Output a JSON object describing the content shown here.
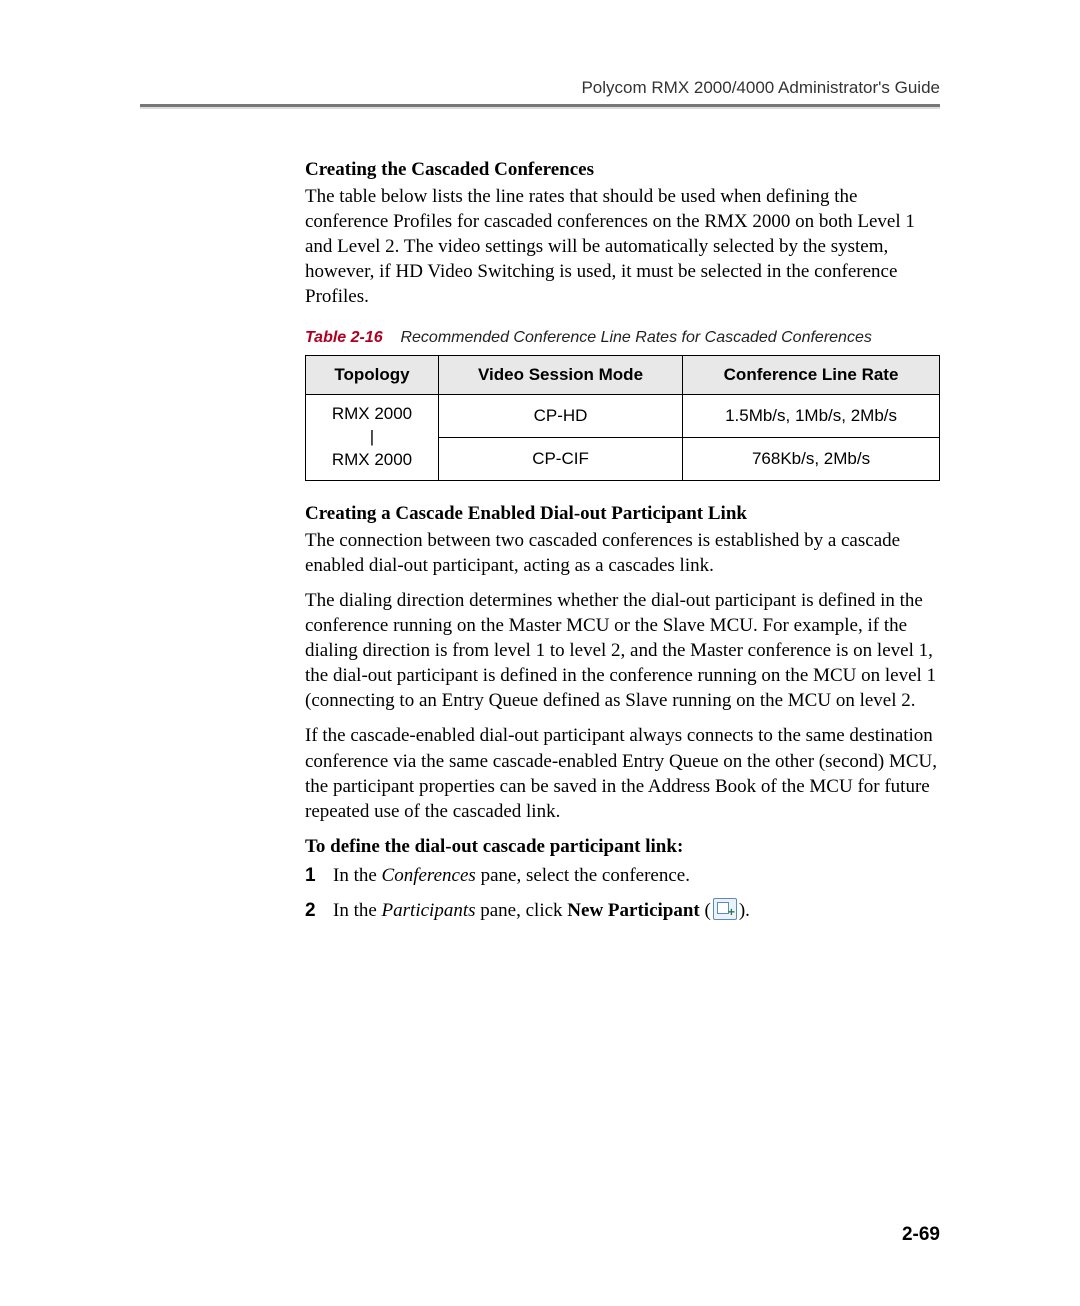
{
  "header": {
    "title": "Polycom RMX 2000/4000 Administrator's Guide"
  },
  "section1": {
    "title": "Creating the Cascaded Conferences",
    "para": "The table below lists the line rates that should be used when defining the conference Profiles for cascaded conferences on the RMX 2000 on both Level 1 and Level 2. The video settings will be automatically selected by the system, however, if HD Video Switching is used, it must be selected in the conference Profiles."
  },
  "table": {
    "caption_label": "Table 2-16",
    "caption_text": "Recommended Conference Line Rates for Cascaded Conferences",
    "headers": {
      "c1": "Topology",
      "c2": "Video Session Mode",
      "c3": "Conference Line Rate"
    },
    "topology_line1": "RMX 2000",
    "topology_line2": "|",
    "topology_line3": "RMX 2000",
    "rows": [
      {
        "mode": "CP-HD",
        "rate": "1.5Mb/s, 1Mb/s, 2Mb/s"
      },
      {
        "mode": "CP-CIF",
        "rate": "768Kb/s, 2Mb/s"
      }
    ]
  },
  "section2": {
    "title": "Creating a Cascade Enabled Dial-out Participant Link",
    "para1": "The connection between two cascaded conferences is established by a cascade enabled dial-out participant, acting as a cascades link.",
    "para2": "The dialing direction determines whether the dial-out participant is defined in the conference running on the Master MCU or the Slave MCU. For example, if the dialing direction is from level 1 to level 2, and the Master conference is on level 1, the dial-out participant is defined in the conference running on the MCU on level 1 (connecting to an Entry Queue defined as Slave running on the MCU on level 2.",
    "para3": "If the cascade-enabled dial-out participant always connects to the same destination conference via the same cascade-enabled Entry Queue on the other (second) MCU, the participant properties can be saved in the Address Book of the MCU for future repeated use of the cascaded link."
  },
  "procedure": {
    "title": "To define the dial-out cascade participant link:",
    "steps": {
      "s1": {
        "num": "1",
        "pre": "In the ",
        "it": "Conferences",
        "post": " pane, select the conference."
      },
      "s2": {
        "num": "2",
        "pre": "In the ",
        "it": "Participants",
        "mid": " pane, click ",
        "bd": "New Participant",
        "open": " (",
        "close": ")."
      }
    }
  },
  "footer": {
    "page_number": "2-69"
  }
}
